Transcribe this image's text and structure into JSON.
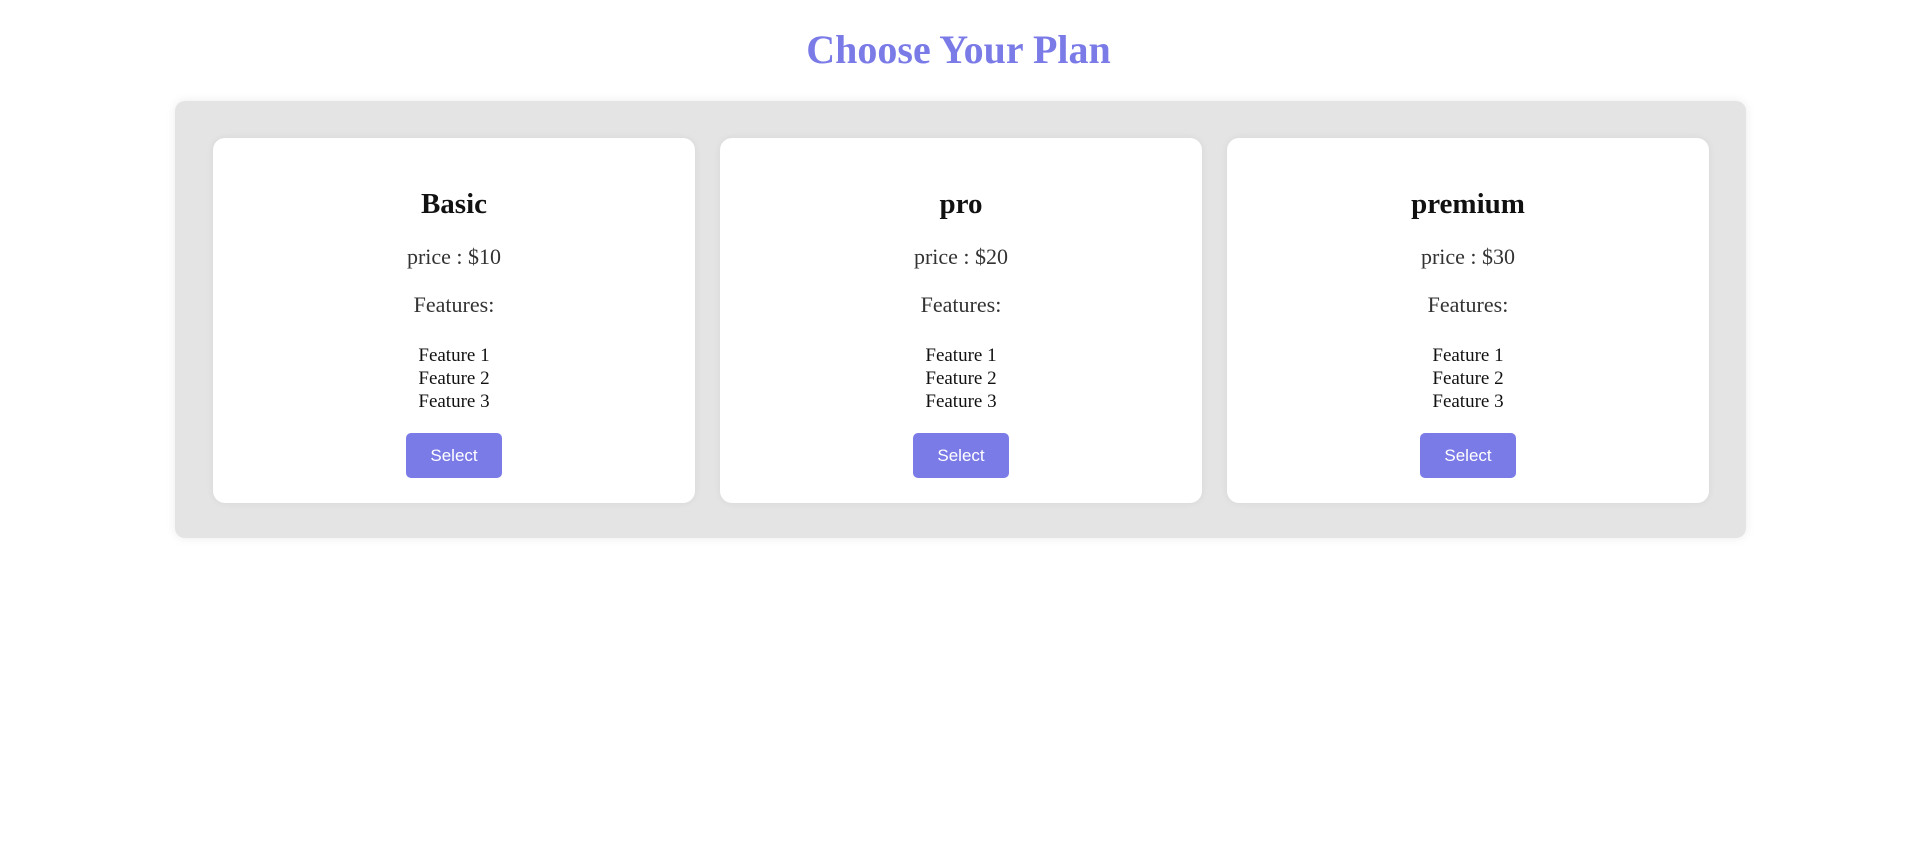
{
  "page": {
    "title": "Choose Your Plan"
  },
  "colors": {
    "accent": "#7b7be8",
    "panel_background": "#e4e4e4",
    "card_background": "#ffffff"
  },
  "plans": [
    {
      "name": "Basic",
      "price": "price : $10",
      "features_label": "Features:",
      "features": [
        "Feature 1",
        "Feature 2",
        "Feature 3"
      ],
      "button_label": "Select"
    },
    {
      "name": "pro",
      "price": "price : $20",
      "features_label": "Features:",
      "features": [
        "Feature 1",
        "Feature 2",
        "Feature 3"
      ],
      "button_label": "Select"
    },
    {
      "name": "premium",
      "price": "price : $30",
      "features_label": "Features:",
      "features": [
        "Feature 1",
        "Feature 2",
        "Feature 3"
      ],
      "button_label": "Select"
    }
  ]
}
